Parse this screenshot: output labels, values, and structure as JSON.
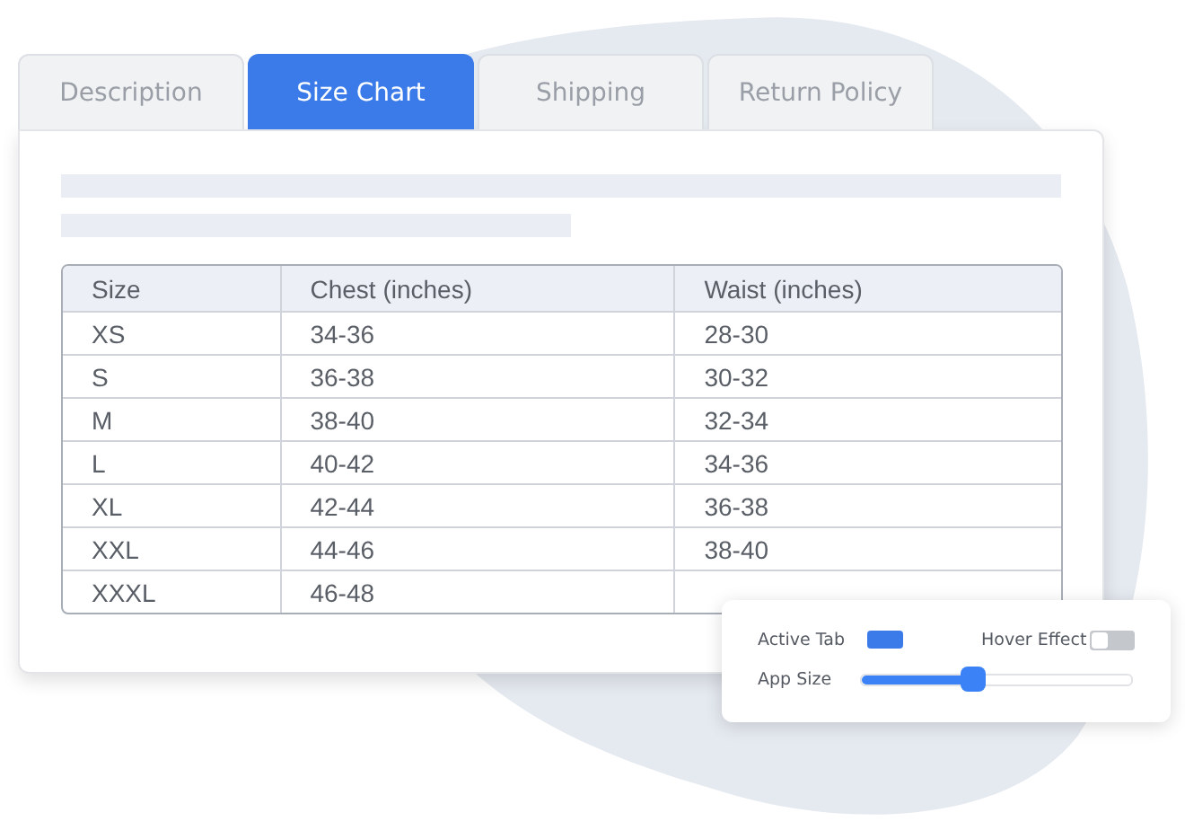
{
  "tabs": [
    {
      "label": "Description",
      "selected": false
    },
    {
      "label": "Size Chart",
      "selected": true
    },
    {
      "label": "Shipping",
      "selected": false
    },
    {
      "label": "Return Policy",
      "selected": false
    }
  ],
  "table": {
    "columns": [
      "Size",
      "Chest (inches)",
      "Waist (inches)"
    ],
    "rows": [
      [
        "XS",
        "34-36",
        "28-30"
      ],
      [
        "S",
        "36-38",
        "30-32"
      ],
      [
        "M",
        "38-40",
        "32-34"
      ],
      [
        "L",
        "40-42",
        "34-36"
      ],
      [
        "XL",
        "42-44",
        "36-38"
      ],
      [
        "XXL",
        "44-46",
        "38-40"
      ],
      [
        "XXXL",
        "46-48"
      ]
    ]
  },
  "settings": {
    "active_tab": {
      "label": "Active Tab"
    },
    "hover_effect": {
      "label": "Hover Effect",
      "on": false
    },
    "app_size": {
      "label": "App Size",
      "level": 0.41
    }
  }
}
